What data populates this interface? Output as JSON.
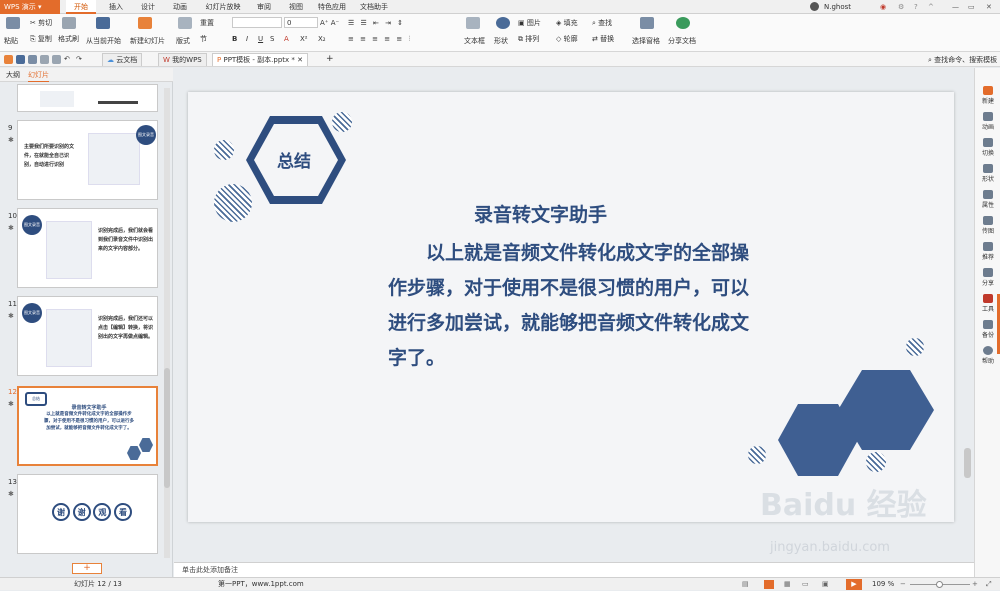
{
  "app": {
    "name": "WPS 演示"
  },
  "menu": {
    "tabs": [
      "开始",
      "插入",
      "设计",
      "动画",
      "幻灯片放映",
      "审阅",
      "视图",
      "特色应用",
      "文档助手"
    ],
    "active": "开始"
  },
  "user": {
    "name": "N.ghost"
  },
  "ribbon": {
    "paste": "粘贴",
    "cut": "剪切",
    "copy": "复制",
    "format_painter": "格式刷",
    "from_current": "从当前开始",
    "new_slide": "新建幻灯片",
    "layout": "版式",
    "section": "节",
    "reset": "重置",
    "font_size": "0",
    "textbox": "文本框",
    "shape": "形状",
    "picture": "图片",
    "arrange": "排列",
    "fill": "填充",
    "outline": "轮廓",
    "find": "查找",
    "replace": "替换",
    "select_pane": "选择窗格",
    "share_doc": "分享文档"
  },
  "quickbar": {
    "tabs": [
      "云文档",
      "我的WPS",
      "PPT模板 - 副本.pptx *"
    ],
    "search": "查找命令、搜索模板"
  },
  "left_panel": {
    "tabs": [
      "大纲",
      "幻灯片"
    ],
    "slides": [
      {
        "num": "9",
        "text": "主要我们所要识别的文件，在就能全自己识别，自动进行识别",
        "badge": "图文录音"
      },
      {
        "num": "10",
        "text": "识别完成后，我们就会看到我们录音文件中识别出来的文字内容部分。",
        "badge": "图文录音"
      },
      {
        "num": "11",
        "text": "识别完成后，我们还可以点击【编辑】转换，将识别出的文字再做点编辑。",
        "badge": "图文录音"
      },
      {
        "num": "12",
        "thumb_title": "录音转文字助手",
        "thumb_body": "以上就是音频文件转化成文字的全部操作步骤，对于使用不是很习惯的用户，可以进行多加尝试，就能够把音频文件转化成文字了。",
        "badge": "总结"
      },
      {
        "num": "13",
        "thumb_words": [
          "谢",
          "谢",
          "观",
          "看"
        ]
      }
    ]
  },
  "slide": {
    "badge": "总结",
    "title": "录音转文字助手",
    "body": "以上就是音频文件转化成文字的全部操作步骤，对于使用不是很习惯的用户，可以进行多加尝试，就能够把音频文件转化成文字了。"
  },
  "notes": {
    "placeholder": "单击此处添加备注"
  },
  "right_panel": {
    "items": [
      "新建",
      "动画",
      "切换",
      "形状",
      "属性",
      "传图",
      "推荐",
      "分享",
      "工具",
      "备份",
      "帮助"
    ]
  },
  "status": {
    "slide_counter": "幻灯片 12 / 13",
    "template": "第一PPT，www.1ppt.com",
    "zoom": "109 %"
  },
  "watermark": {
    "main": "Baidu 经验",
    "sub": "jingyan.baidu.com"
  },
  "colors": {
    "accent": "#e36c2b",
    "navy": "#2e4d7f",
    "hex_blue": "#4a6b98"
  }
}
